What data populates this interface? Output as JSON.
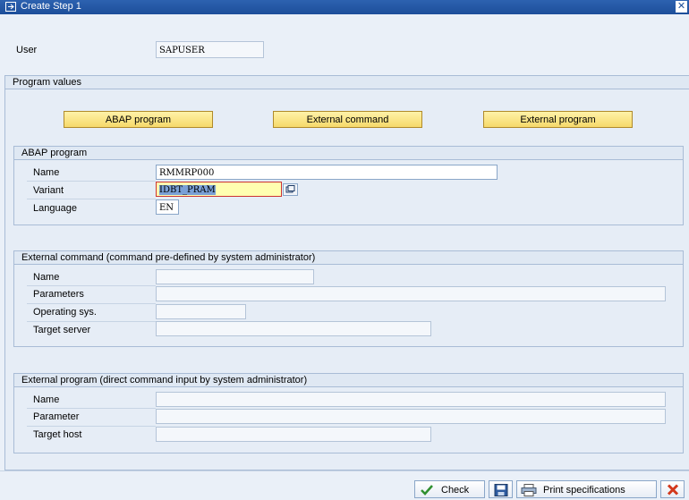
{
  "window": {
    "title": "Create Step  1",
    "close_glyph": "✕"
  },
  "user": {
    "label": "User",
    "value": "SAPUSER"
  },
  "program_values": {
    "heading": "Program values",
    "buttons": [
      "ABAP program",
      "External command",
      "External program"
    ]
  },
  "abap_program": {
    "heading": "ABAP program",
    "name_label": "Name",
    "name_value": "RMMRP000",
    "variant_label": "Variant",
    "variant_value": "IDBT_PRAM",
    "language_label": "Language",
    "language_value": "EN"
  },
  "external_command": {
    "heading": "External command (command pre-defined by system administrator)",
    "name_label": "Name",
    "parameters_label": "Parameters",
    "os_label": "Operating sys.",
    "target_label": "Target server"
  },
  "external_program": {
    "heading": "External program (direct command input by system administrator)",
    "name_label": "Name",
    "parameter_label": "Parameter",
    "target_label": "Target host"
  },
  "footer": {
    "check_label": "Check",
    "print_label": "Print specifications"
  },
  "colors": {
    "accent": "#1d4e9a",
    "button_yellow": "#f6d96a",
    "cancel_red": "#d2381c",
    "check_green": "#2f8f2f"
  }
}
